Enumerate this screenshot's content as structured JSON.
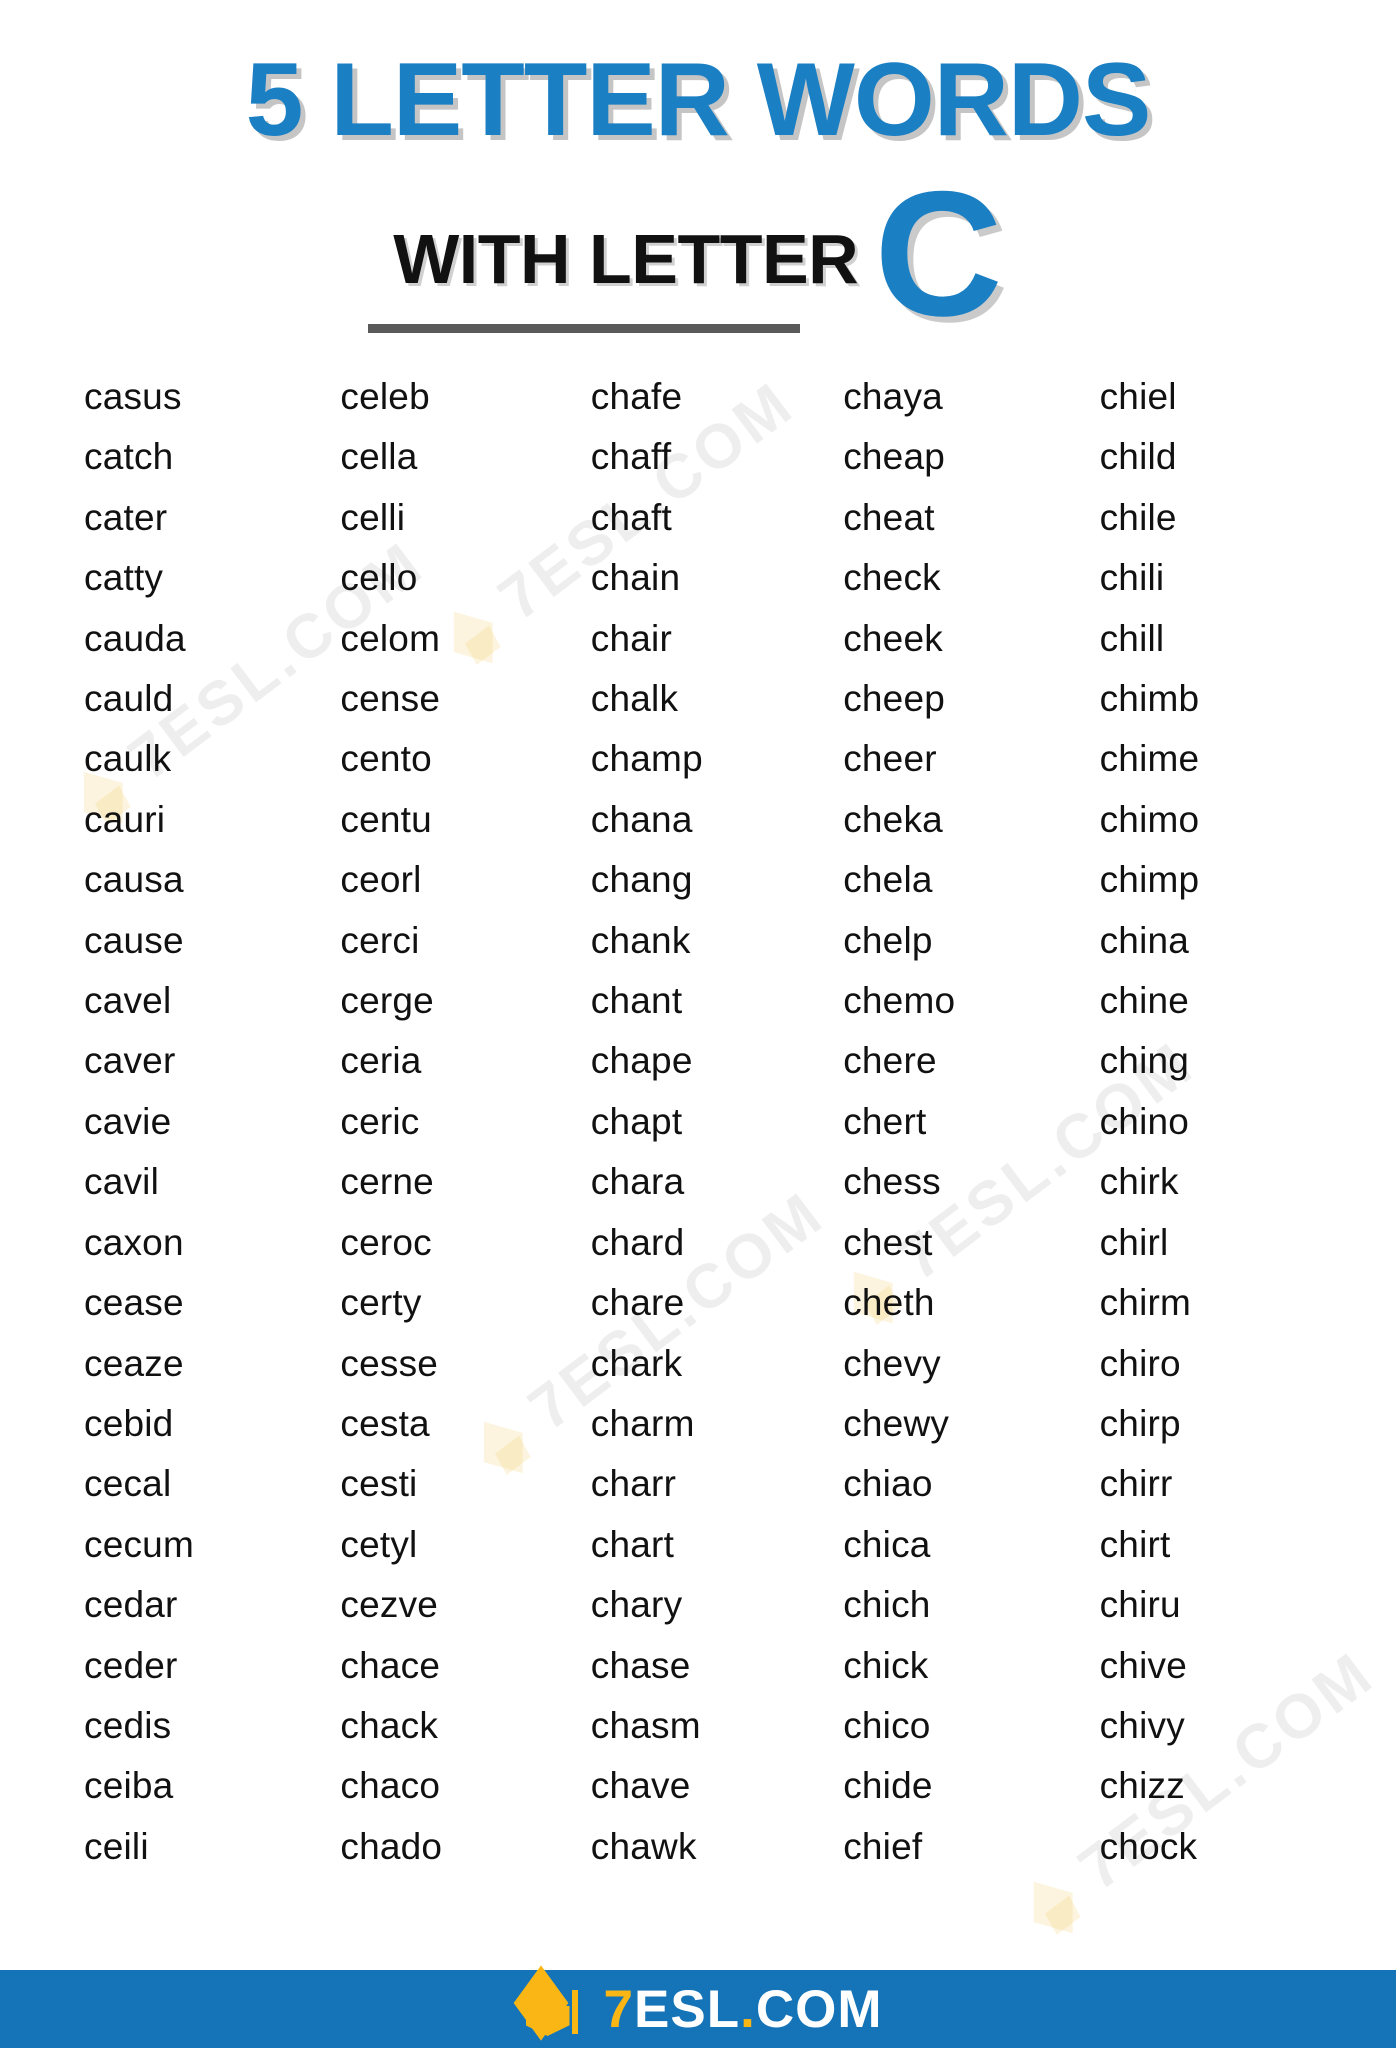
{
  "header": {
    "title_main": "5 LETTER WORDS",
    "title_sub": "WITH LETTER",
    "title_letter": "C",
    "accent_color": "#1b7fc4",
    "sub_color": "#111111",
    "divider_color": "#5a5a5a"
  },
  "watermark": {
    "text": "7ESL.COM"
  },
  "columns": [
    {
      "index": 1,
      "words": [
        "casus",
        "catch",
        "cater",
        "catty",
        "cauda",
        "cauld",
        "caulk",
        "cauri",
        "causa",
        "cause",
        "cavel",
        "caver",
        "cavie",
        "cavil",
        "caxon",
        "cease",
        "ceaze",
        "cebid",
        "cecal",
        "cecum",
        "cedar",
        "ceder",
        "cedis",
        "ceiba",
        "ceili"
      ]
    },
    {
      "index": 2,
      "words": [
        "celeb",
        "cella",
        "celli",
        "cello",
        "celom",
        "cense",
        "cento",
        "centu",
        "ceorl",
        "cerci",
        "cerge",
        "ceria",
        "ceric",
        "cerne",
        "ceroc",
        "certy",
        "cesse",
        "cesta",
        "cesti",
        "cetyl",
        "cezve",
        "chace",
        "chack",
        "chaco",
        "chado"
      ]
    },
    {
      "index": 3,
      "words": [
        "chafe",
        "chaff",
        "chaft",
        "chain",
        "chair",
        "chalk",
        "champ",
        "chana",
        "chang",
        "chank",
        "chant",
        "chape",
        "chapt",
        "chara",
        "chard",
        "chare",
        "chark",
        "charm",
        "charr",
        "chart",
        "chary",
        "chase",
        "chasm",
        "chave",
        "chawk"
      ]
    },
    {
      "index": 4,
      "words": [
        "chaya",
        "cheap",
        "cheat",
        "check",
        "cheek",
        "cheep",
        "cheer",
        "cheka",
        "chela",
        "chelp",
        "chemo",
        "chere",
        "chert",
        "chess",
        "chest",
        "cheth",
        "chevy",
        "chewy",
        "chiao",
        "chica",
        "chich",
        "chick",
        "chico",
        "chide",
        "chief"
      ]
    },
    {
      "index": 5,
      "words": [
        "chiel",
        "child",
        "chile",
        "chili",
        "chill",
        "chimb",
        "chime",
        "chimo",
        "chimp",
        "china",
        "chine",
        "ching",
        "chino",
        "chirk",
        "chirl",
        "chirm",
        "chiro",
        "chirp",
        "chirr",
        "chirt",
        "chiru",
        "chive",
        "chivy",
        "chizz",
        "chock"
      ]
    }
  ],
  "footer": {
    "brand_seven": "7",
    "brand_esl": "ESL",
    "brand_dot": ".",
    "brand_com": "COM",
    "bar_color": "#1574b8",
    "accent_color": "#f9b615"
  }
}
